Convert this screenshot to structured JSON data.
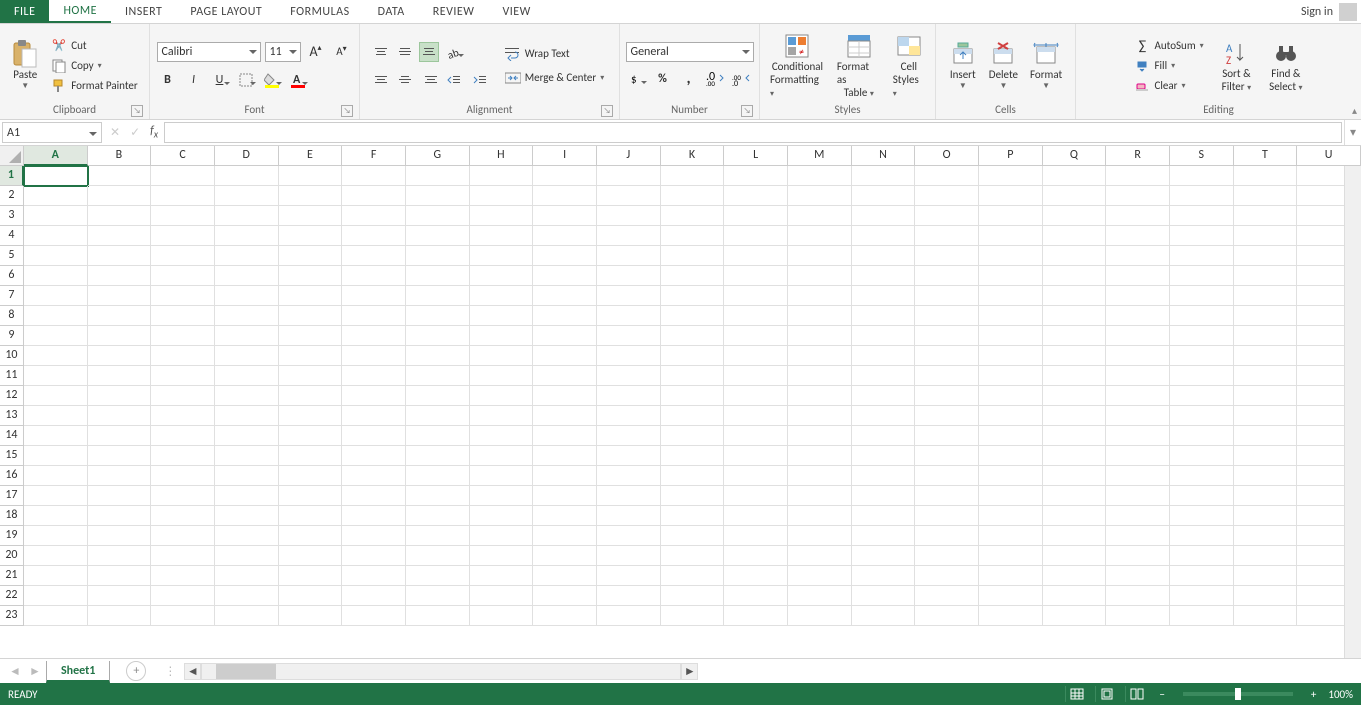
{
  "tabs": {
    "file": "FILE",
    "home": "HOME",
    "insert": "INSERT",
    "page_layout": "PAGE LAYOUT",
    "formulas": "FORMULAS",
    "data": "DATA",
    "review": "REVIEW",
    "view": "VIEW"
  },
  "signin": "Sign in",
  "ribbon": {
    "clipboard": {
      "label": "Clipboard",
      "paste": "Paste",
      "cut": "Cut",
      "copy": "Copy",
      "format_painter": "Format Painter"
    },
    "font": {
      "label": "Font",
      "name": "Calibri",
      "size": "11"
    },
    "alignment": {
      "label": "Alignment",
      "wrap": "Wrap Text",
      "merge": "Merge & Center"
    },
    "number": {
      "label": "Number",
      "format": "General"
    },
    "styles": {
      "label": "Styles",
      "conditional_fmt1": "Conditional",
      "conditional_fmt2": "Formatting",
      "table1": "Format as",
      "table2": "Table",
      "cell1": "Cell",
      "cell2": "Styles"
    },
    "cells": {
      "label": "Cells",
      "insert": "Insert",
      "delete": "Delete",
      "format": "Format"
    },
    "editing": {
      "label": "Editing",
      "autosum": "AutoSum",
      "fill": "Fill",
      "clear": "Clear",
      "sort1": "Sort &",
      "sort2": "Filter",
      "find1": "Find &",
      "find2": "Select"
    }
  },
  "namebox": "A1",
  "columns": [
    "A",
    "B",
    "C",
    "D",
    "E",
    "F",
    "G",
    "H",
    "I",
    "J",
    "K",
    "L",
    "M",
    "N",
    "O",
    "P",
    "Q",
    "R",
    "S",
    "T",
    "U"
  ],
  "rows": [
    "1",
    "2",
    "3",
    "4",
    "5",
    "6",
    "7",
    "8",
    "9",
    "10",
    "11",
    "12",
    "13",
    "14",
    "15",
    "16",
    "17",
    "18",
    "19",
    "20",
    "21",
    "22",
    "23"
  ],
  "sheet": "Sheet1",
  "status": {
    "ready": "READY",
    "zoom": "100%"
  }
}
